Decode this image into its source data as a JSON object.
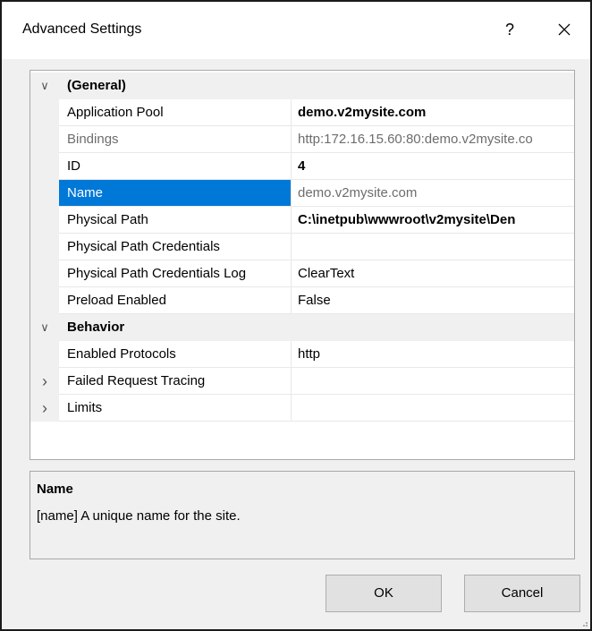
{
  "window": {
    "title": "Advanced Settings",
    "help_label": "?",
    "close_icon": "close-icon"
  },
  "grid": {
    "rows": [
      {
        "type": "category",
        "label": "(General)",
        "expander": "chevron-down-icon"
      },
      {
        "type": "property",
        "name": "Application Pool",
        "value": "demo.v2mysite.com",
        "value_style": "bold"
      },
      {
        "type": "property",
        "name": "Bindings",
        "value": "http:172.16.15.60:80:demo.v2mysite.co",
        "value_style": "gray",
        "name_style": "gray"
      },
      {
        "type": "property",
        "name": "ID",
        "value": "4",
        "value_style": "bold"
      },
      {
        "type": "property",
        "name": "Name",
        "value": "demo.v2mysite.com",
        "value_style": "gray",
        "selected": true
      },
      {
        "type": "property",
        "name": "Physical Path",
        "value": "C:\\inetpub\\wwwroot\\v2mysite\\Den",
        "value_style": "bold"
      },
      {
        "type": "property",
        "name": "Physical Path Credentials",
        "value": ""
      },
      {
        "type": "property",
        "name": "Physical Path Credentials Log",
        "value": "ClearText"
      },
      {
        "type": "property",
        "name": "Preload Enabled",
        "value": "False"
      },
      {
        "type": "category",
        "label": "Behavior",
        "expander": "chevron-down-icon"
      },
      {
        "type": "property",
        "name": "Enabled Protocols",
        "value": "http"
      },
      {
        "type": "property",
        "name": "Failed Request Tracing",
        "value": "",
        "expander": "chevron-right-icon"
      },
      {
        "type": "property",
        "name": "Limits",
        "value": "",
        "expander": "chevron-right-icon"
      }
    ]
  },
  "description": {
    "title": "Name",
    "text": "[name] A unique name for the site."
  },
  "buttons": {
    "ok": "OK",
    "cancel": "Cancel"
  },
  "colors": {
    "selection": "#0078d7",
    "dialog_bg": "#f0f0f0"
  }
}
